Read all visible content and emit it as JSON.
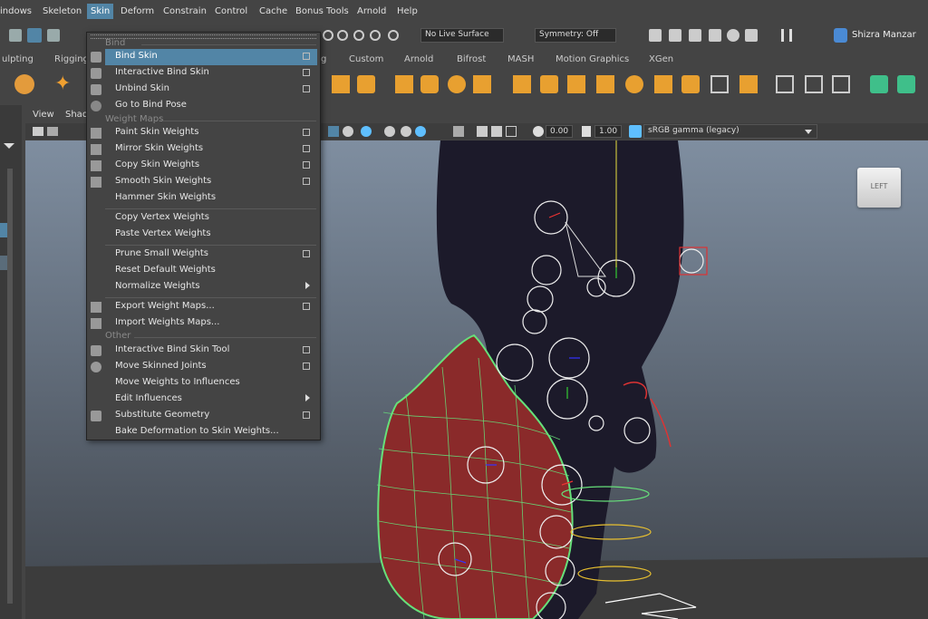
{
  "menubar": {
    "items": [
      "indows",
      "Skeleton",
      "Skin",
      "Deform",
      "Constrain",
      "Control",
      "Cache",
      "Bonus Tools",
      "Arnold",
      "Help"
    ],
    "active": "Skin"
  },
  "statusline": {
    "live_surface": "No Live Surface",
    "symmetry": "Symmetry: Off",
    "user": "Shizra Manzar"
  },
  "shelf": {
    "tabs": [
      "ulpting",
      "Rigging",
      "g",
      "Custom",
      "Arnold",
      "Bifrost",
      "MASH",
      "Motion Graphics",
      "XGen"
    ]
  },
  "viewport": {
    "menus": [
      "View",
      "Shad"
    ],
    "near_value": "0.00",
    "far_value": "1.00",
    "color_space": "sRGB gamma (legacy)",
    "view_cube_label": "LEFT"
  },
  "skin_menu": {
    "sections": {
      "bind": "Bind",
      "weight_maps": "Weight Maps",
      "other": "Other"
    },
    "items": [
      {
        "label": "Bind Skin",
        "option": true,
        "highlighted": true
      },
      {
        "label": "Interactive Bind Skin",
        "option": true
      },
      {
        "label": "Unbind Skin",
        "option": true
      },
      {
        "label": "Go to Bind Pose",
        "option": false
      },
      {
        "label": "Paint Skin Weights",
        "option": true
      },
      {
        "label": "Mirror Skin Weights",
        "option": true
      },
      {
        "label": "Copy Skin Weights",
        "option": true
      },
      {
        "label": "Smooth Skin Weights",
        "option": true
      },
      {
        "label": "Hammer Skin Weights",
        "option": false
      },
      {
        "label": "Copy Vertex Weights",
        "option": false
      },
      {
        "label": "Paste Vertex Weights",
        "option": false
      },
      {
        "label": "Prune Small Weights",
        "option": true
      },
      {
        "label": "Reset Default Weights",
        "option": false
      },
      {
        "label": "Normalize Weights",
        "submenu": true
      },
      {
        "label": "Export Weight Maps...",
        "option": true
      },
      {
        "label": "Import Weights Maps...",
        "option": false
      },
      {
        "label": "Interactive Bind Skin Tool",
        "option": true
      },
      {
        "label": "Move Skinned Joints",
        "option": true
      },
      {
        "label": "Move Weights to Influences",
        "option": false
      },
      {
        "label": "Edit Influences",
        "submenu": true
      },
      {
        "label": "Substitute Geometry",
        "option": true
      },
      {
        "label": "Bake Deformation to Skin Weights...",
        "option": false
      }
    ]
  },
  "colors": {
    "highlight": "#5285a6",
    "mesh_red": "#8a2a2a",
    "wire_green": "#66e07a",
    "body_dark": "#1c1a2a"
  }
}
